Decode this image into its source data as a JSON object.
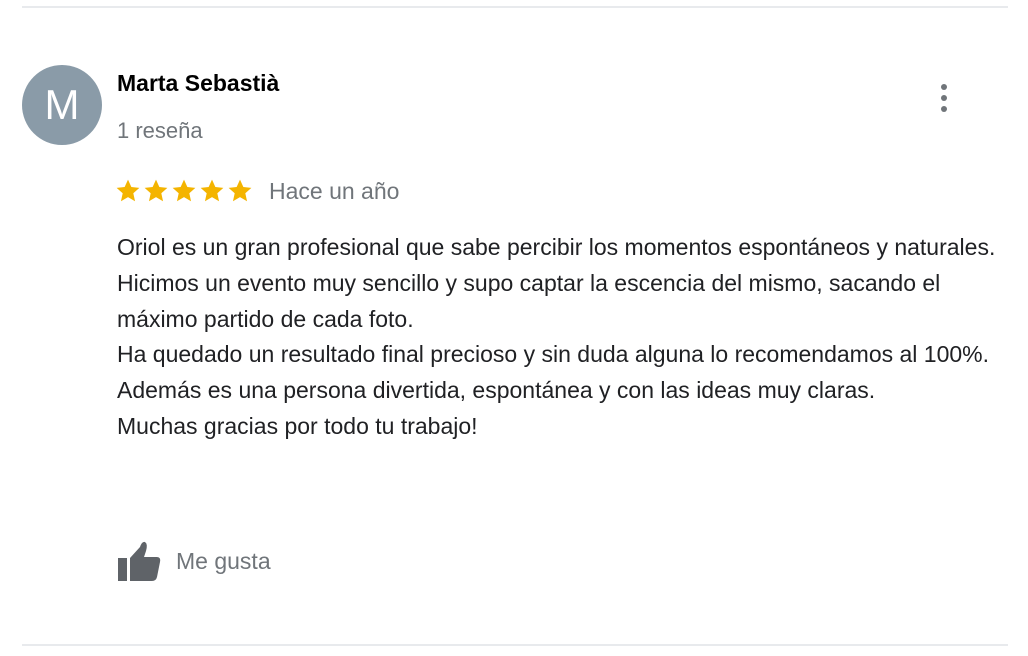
{
  "review": {
    "avatar_letter": "M",
    "avatar_color": "#8a9ba8",
    "author_name": "Marta Sebastià",
    "author_review_count": "1 reseña",
    "more_options_icon": "more-vert-icon",
    "rating": 5,
    "rating_max": 5,
    "star_color": "#f4b400",
    "date": "Hace un año",
    "text_lines": [
      "Oriol es un gran profesional que  sabe percibir los  momentos espontáneos y naturales.",
      "Hicimos un evento muy sencillo y supo captar  la escencia del mismo, sacando el máximo partido de cada foto.",
      "Ha quedado un resultado final precioso y sin duda alguna lo recomendamos al 100%. Además es una persona divertida, espontánea y con las ideas muy claras.",
      "Muchas gracias por todo tu trabajo!"
    ],
    "like_icon": "thumbs-up-icon",
    "like_label": "Me gusta"
  }
}
